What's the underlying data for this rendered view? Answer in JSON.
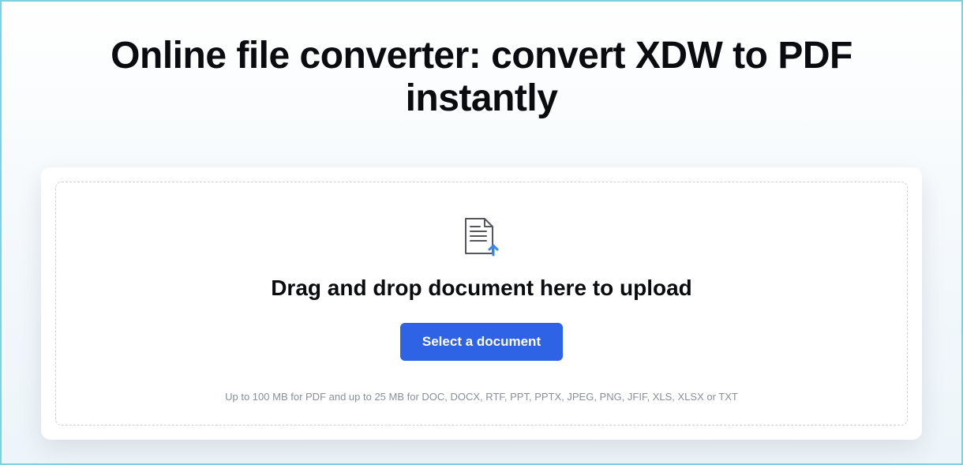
{
  "title": "Online file converter: convert XDW to PDF instantly",
  "dropzone": {
    "heading": "Drag and drop document here to upload",
    "button_label": "Select a document",
    "limits_text": "Up to 100 MB for PDF and up to 25 MB for DOC, DOCX, RTF, PPT, PPTX, JPEG, PNG, JFIF, XLS, XLSX or TXT"
  }
}
